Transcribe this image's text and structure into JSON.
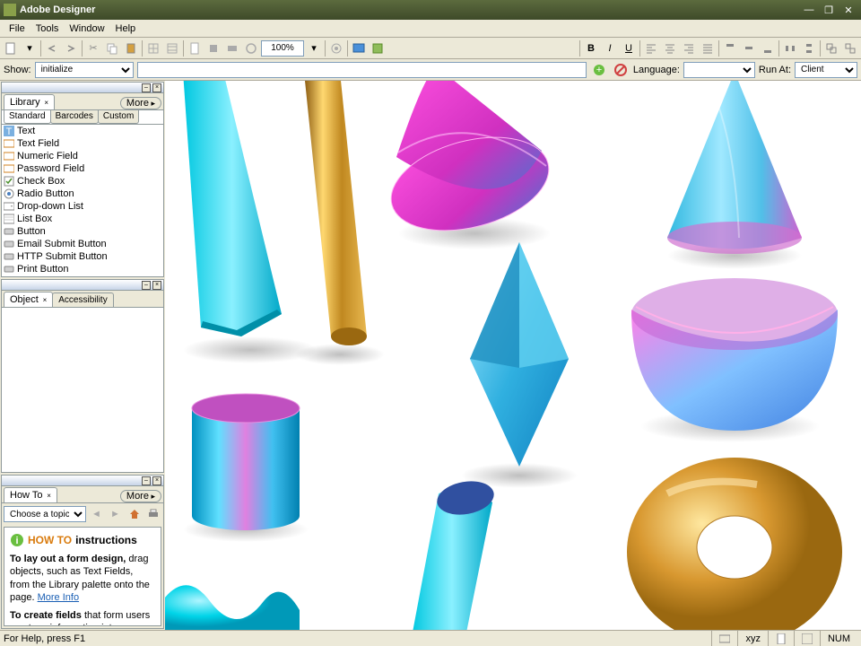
{
  "title": "Adobe Designer",
  "menu": [
    "File",
    "Tools",
    "Window",
    "Help"
  ],
  "zoom": "100%",
  "show_label": "Show:",
  "show_value": "initialize",
  "lang_label": "Language:",
  "runat_label": "Run At:",
  "runat_value": "Client",
  "library": {
    "title": "Library",
    "more": "More",
    "subtabs": [
      "Standard",
      "Barcodes",
      "Custom"
    ],
    "items": [
      "Text",
      "Text Field",
      "Numeric Field",
      "Password Field",
      "Check Box",
      "Radio Button",
      "Drop-down List",
      "List Box",
      "Button",
      "Email Submit Button",
      "HTTP Submit Button",
      "Print Button"
    ]
  },
  "object": {
    "title": "Object",
    "tab2": "Accessibility"
  },
  "howto": {
    "title": "How To",
    "more": "More",
    "topic": "Choose a topic...",
    "head_a": "HOW TO",
    "head_b": "instructions",
    "p1a": "To lay out a form design,",
    "p1b": " drag objects, such as Text Fields, from the Library palette onto the page. ",
    "link": "More Info",
    "p2a": "To create fields",
    "p2b": " that form users can type information into, use text field objects. "
  },
  "status": {
    "help": "For Help, press F1",
    "num": "NUM"
  }
}
